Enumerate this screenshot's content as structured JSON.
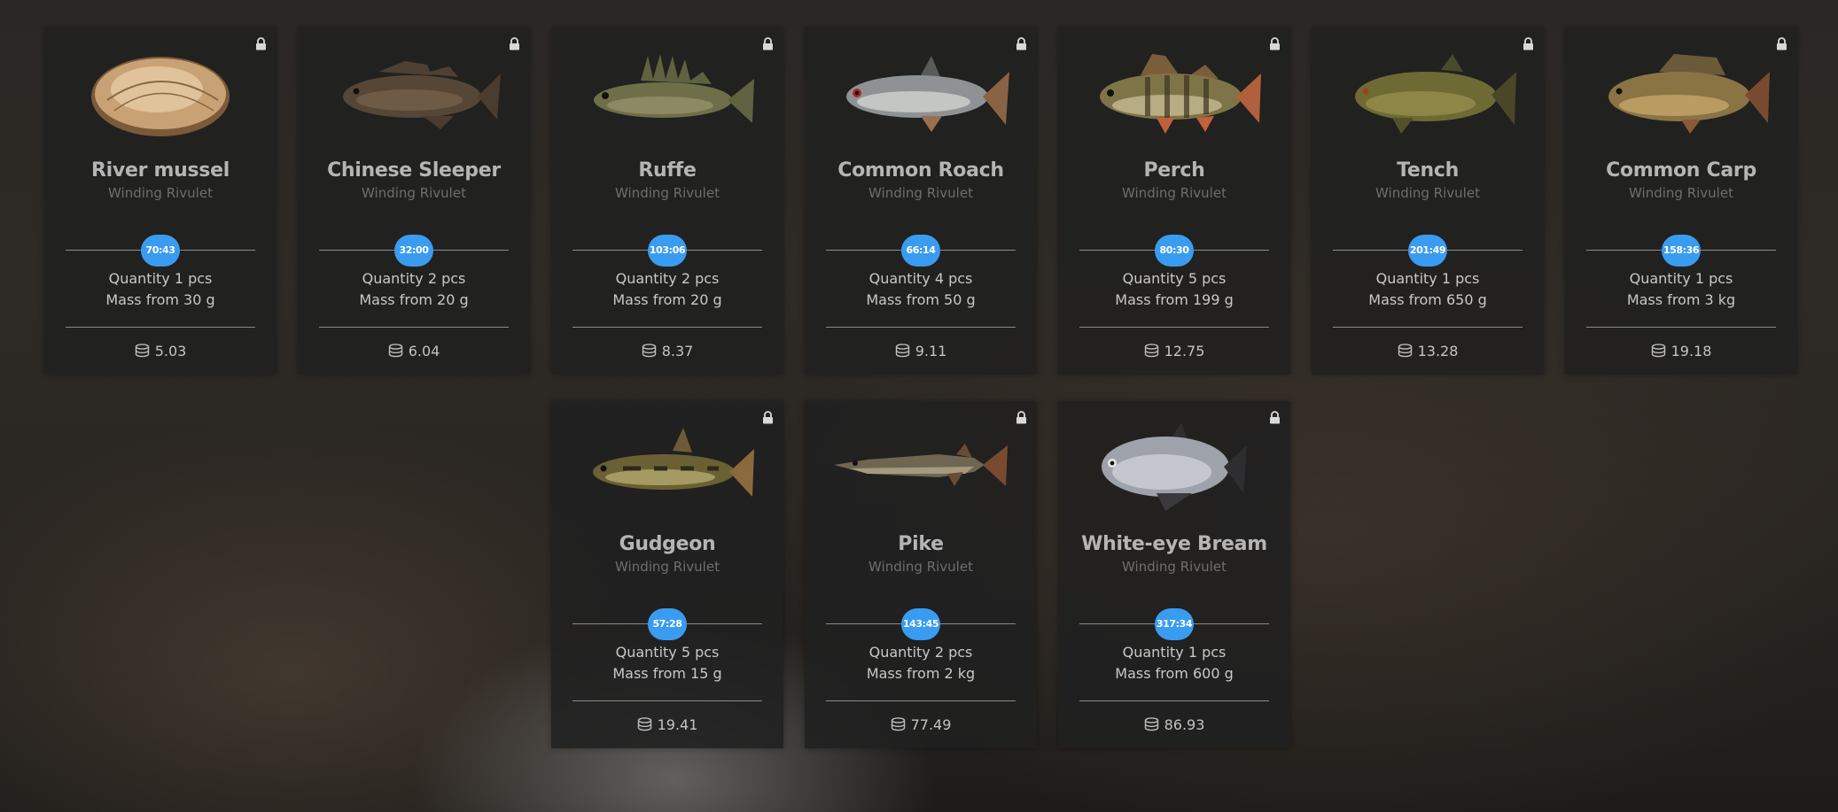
{
  "colors": {
    "timer": "#3a9cf0",
    "card": "#202020",
    "name": "#b5b5b5",
    "location": "#6e6e6e"
  },
  "icons": {
    "lock": "lock-icon",
    "currency": "coins-icon"
  },
  "cards": [
    {
      "name": "River mussel",
      "location": "Winding Rivulet",
      "timer": "70:43",
      "quantity": "Quantity 1 pcs",
      "mass": "Mass from 30 g",
      "price": "5.03",
      "image": "river-mussel-image"
    },
    {
      "name": "Chinese Sleeper",
      "location": "Winding Rivulet",
      "timer": "32:00",
      "quantity": "Quantity 2 pcs",
      "mass": "Mass from 20 g",
      "price": "6.04",
      "image": "chinese-sleeper-image"
    },
    {
      "name": "Ruffe",
      "location": "Winding Rivulet",
      "timer": "103:06",
      "quantity": "Quantity 2 pcs",
      "mass": "Mass from 20 g",
      "price": "8.37",
      "image": "ruffe-image"
    },
    {
      "name": "Common Roach",
      "location": "Winding Rivulet",
      "timer": "66:14",
      "quantity": "Quantity 4 pcs",
      "mass": "Mass from 50 g",
      "price": "9.11",
      "image": "common-roach-image"
    },
    {
      "name": "Perch",
      "location": "Winding Rivulet",
      "timer": "80:30",
      "quantity": "Quantity 5 pcs",
      "mass": "Mass from 199 g",
      "price": "12.75",
      "image": "perch-image"
    },
    {
      "name": "Tench",
      "location": "Winding Rivulet",
      "timer": "201:49",
      "quantity": "Quantity 1 pcs",
      "mass": "Mass from 650 g",
      "price": "13.28",
      "image": "tench-image"
    },
    {
      "name": "Common Carp",
      "location": "Winding Rivulet",
      "timer": "158:36",
      "quantity": "Quantity 1 pcs",
      "mass": "Mass from 3 kg",
      "price": "19.18",
      "image": "common-carp-image"
    },
    {
      "name": "Gudgeon",
      "location": "Winding Rivulet",
      "timer": "57:28",
      "quantity": "Quantity 5 pcs",
      "mass": "Mass from 15 g",
      "price": "19.41",
      "image": "gudgeon-image"
    },
    {
      "name": "Pike",
      "location": "Winding Rivulet",
      "timer": "143:45",
      "quantity": "Quantity 2 pcs",
      "mass": "Mass from 2 kg",
      "price": "77.49",
      "image": "pike-image"
    },
    {
      "name": "White-eye Bream",
      "location": "Winding Rivulet",
      "timer": "317:34",
      "quantity": "Quantity 1 pcs",
      "mass": "Mass from 600 g",
      "price": "86.93",
      "image": "white-eye-bream-image"
    }
  ]
}
